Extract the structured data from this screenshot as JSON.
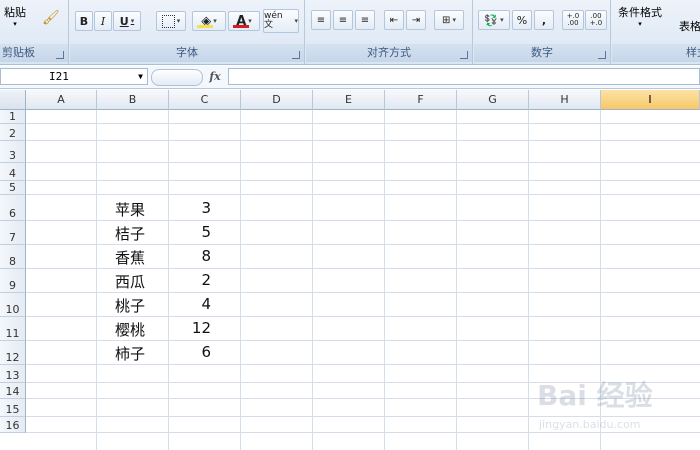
{
  "ribbon": {
    "clipboard": {
      "label": "剪贴板",
      "paste_label": "粘贴"
    },
    "font": {
      "label": "字体",
      "bold": "B",
      "italic": "I",
      "underline": "U",
      "font_color_letter": "A",
      "phonetic_label": "wén 文"
    },
    "alignment": {
      "label": "对齐方式"
    },
    "number": {
      "label": "数字",
      "percent": "%",
      "comma": ",",
      "inc_decimal": "+.0 .00",
      "dec_decimal": ".00 +.0"
    },
    "styles": {
      "label": "样式",
      "conditional_format": "条件格式",
      "table_format": "表格格"
    }
  },
  "formula_bar": {
    "name_box": "I21",
    "fx": "fx",
    "content": ""
  },
  "sheet": {
    "columns": [
      "A",
      "B",
      "C",
      "D",
      "E",
      "F",
      "G",
      "H",
      "I"
    ],
    "selected_column": "I",
    "rows": [
      "1",
      "2",
      "3",
      "4",
      "5",
      "6",
      "7",
      "8",
      "9",
      "10",
      "11",
      "12",
      "13",
      "14",
      "15",
      "16"
    ],
    "data": [
      {
        "row": "6",
        "fruit": "苹果",
        "count": "3"
      },
      {
        "row": "7",
        "fruit": "桔子",
        "count": "5"
      },
      {
        "row": "8",
        "fruit": "香蕉",
        "count": "8"
      },
      {
        "row": "9",
        "fruit": "西瓜",
        "count": "2"
      },
      {
        "row": "10",
        "fruit": "桃子",
        "count": "4"
      },
      {
        "row": "11",
        "fruit": "樱桃",
        "count": "12"
      },
      {
        "row": "12",
        "fruit": "柿子",
        "count": "6"
      }
    ]
  },
  "watermark": {
    "text": "Bai 经验",
    "url": "jingyan.baidu.com"
  }
}
